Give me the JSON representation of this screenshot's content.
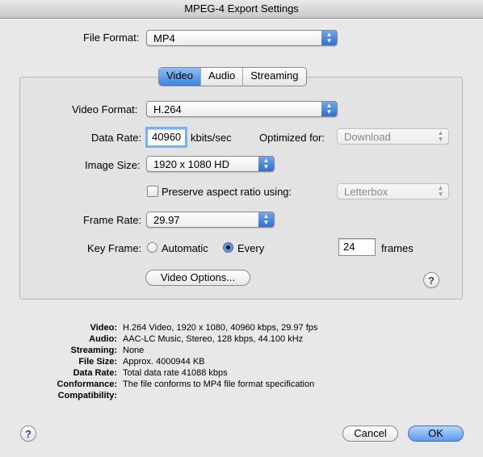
{
  "window": {
    "title": "MPEG-4 Export Settings"
  },
  "file_format": {
    "label": "File Format:",
    "value": "MP4"
  },
  "tabs": [
    {
      "label": "Video"
    },
    {
      "label": "Audio"
    },
    {
      "label": "Streaming"
    }
  ],
  "video": {
    "format_label": "Video Format:",
    "format_value": "H.264",
    "data_rate_label": "Data Rate:",
    "data_rate_value": "40960",
    "data_rate_unit": "kbits/sec",
    "optimized_label": "Optimized for:",
    "optimized_value": "Download",
    "image_size_label": "Image Size:",
    "image_size_value": "1920 x 1080 HD",
    "preserve_label": "Preserve aspect ratio using:",
    "preserve_value": "Letterbox",
    "frame_rate_label": "Frame Rate:",
    "frame_rate_value": "29.97",
    "key_frame_label": "Key Frame:",
    "key_frame_automatic": "Automatic",
    "key_frame_every": "Every",
    "key_frame_value": "24",
    "key_frame_unit": "frames",
    "options_button": "Video Options..."
  },
  "summary": [
    {
      "key": "Video:",
      "value": "H.264 Video, 1920 x 1080, 40960 kbps, 29.97 fps"
    },
    {
      "key": "Audio:",
      "value": "AAC-LC Music, Stereo, 128 kbps, 44.100 kHz"
    },
    {
      "key": "Streaming:",
      "value": "None"
    },
    {
      "key": "File Size:",
      "value": "Approx. 4000944 KB"
    },
    {
      "key": "Data Rate:",
      "value": "Total data rate 41088 kbps"
    },
    {
      "key": "Conformance:",
      "value": "The file conforms to MP4 file format specification"
    },
    {
      "key": "Compatibility:",
      "value": ""
    }
  ],
  "buttons": {
    "cancel": "Cancel",
    "ok": "OK",
    "help": "?"
  }
}
